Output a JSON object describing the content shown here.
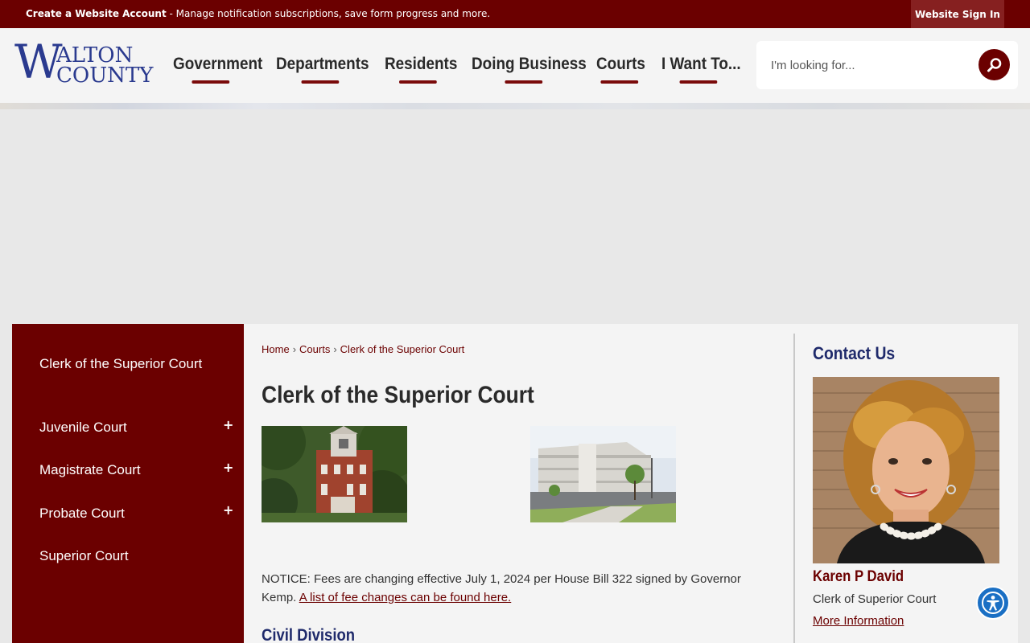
{
  "topbar": {
    "create_account": "Create a Website Account",
    "create_account_desc": " - Manage notification subscriptions, save form progress and more.",
    "signin": "Website Sign In"
  },
  "logo": {
    "letter": "W",
    "line1": "ALTON",
    "line2": "COUNTY"
  },
  "nav": {
    "items": [
      {
        "label": "Government"
      },
      {
        "label": "Departments"
      },
      {
        "label": "Residents"
      },
      {
        "label": "Doing Business"
      },
      {
        "label": "Courts"
      },
      {
        "label": "I Want To..."
      }
    ]
  },
  "search": {
    "placeholder": "I'm looking for...",
    "icon": "search-icon"
  },
  "sidebar": {
    "items": [
      {
        "label": "Clerk of the Superior Court",
        "expand": ""
      },
      {
        "label": "Juvenile Court",
        "expand": "+"
      },
      {
        "label": "Magistrate Court",
        "expand": "+"
      },
      {
        "label": "Probate Court",
        "expand": "+"
      },
      {
        "label": "Superior Court",
        "expand": ""
      }
    ]
  },
  "breadcrumb": {
    "home": "Home",
    "sep": "›",
    "courts": "Courts",
    "current": "Clerk of the Superior Court"
  },
  "main": {
    "title": "Clerk of the Superior Court",
    "notice_text": " NOTICE: Fees are changing effective July 1, 2024 per House Bill 322 signed by Governor Kemp. ",
    "notice_link": "A list of fee changes can be found here.",
    "civil_heading": "Civil Division"
  },
  "contact": {
    "title": "Contact Us",
    "name": "Karen P David",
    "role": "Clerk of Superior Court",
    "more": "More Information"
  },
  "colors": {
    "brand": "#6b0000",
    "navy": "#1f2a6b",
    "accessibility": "#1a6fc4"
  }
}
